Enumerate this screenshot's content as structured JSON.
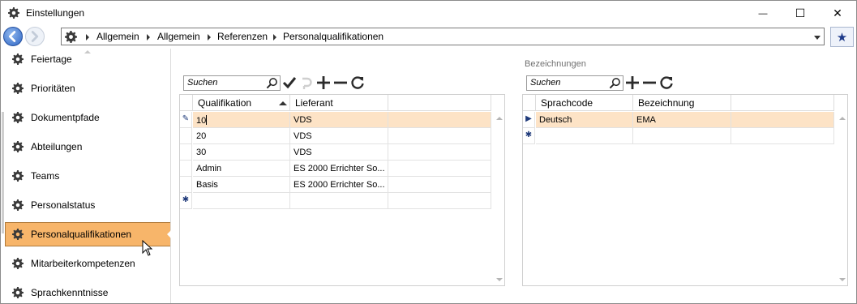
{
  "window": {
    "title": "Einstellungen",
    "minimize_glyph": "—",
    "maximize_glyph": "☐",
    "close_glyph": "✕"
  },
  "breadcrumb": [
    "Allgemein",
    "Allgemein",
    "Referenzen",
    "Personalqualifikationen"
  ],
  "sidebar": {
    "items": [
      {
        "label": "Feiertage"
      },
      {
        "label": "Prioritäten"
      },
      {
        "label": "Dokumentpfade"
      },
      {
        "label": "Abteilungen"
      },
      {
        "label": "Teams"
      },
      {
        "label": "Personalstatus"
      },
      {
        "label": "Personalqualifikationen",
        "selected": true
      },
      {
        "label": "Mitarbeiterkompetenzen"
      },
      {
        "label": "Sprachkenntnisse"
      }
    ]
  },
  "left_grid": {
    "search_placeholder": "Suchen",
    "columns": [
      "Qualifikation",
      "Lieferant"
    ],
    "rows": [
      {
        "qualifikation": "10",
        "lieferant": "VDS",
        "selected": true
      },
      {
        "qualifikation": "20",
        "lieferant": "VDS"
      },
      {
        "qualifikation": "30",
        "lieferant": "VDS"
      },
      {
        "qualifikation": "Admin",
        "lieferant": "ES 2000 Errichter So..."
      },
      {
        "qualifikation": "Basis",
        "lieferant": "ES 2000 Errichter So..."
      }
    ],
    "edit_indicator": "✎",
    "new_row_indicator": "✱"
  },
  "right_section": {
    "title": "Bezeichnungen",
    "search_placeholder": "Suchen",
    "columns": [
      "Sprachcode",
      "Bezeichnung"
    ],
    "rows": [
      {
        "sprachcode": "Deutsch",
        "bezeichnung": "EMA",
        "selected": true
      }
    ],
    "current_indicator": "▶",
    "new_row_indicator": "✱"
  },
  "colors": {
    "selection": "#f7b56a",
    "row_selection": "#fde3c6",
    "back_button": "#2f66c4"
  }
}
